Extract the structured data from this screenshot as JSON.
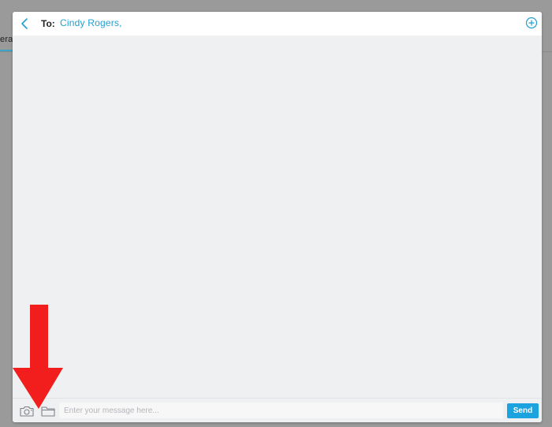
{
  "background_app": {
    "tab_label_fragment": "erac"
  },
  "header": {
    "to_label": "To:",
    "recipient": "Cindy Rogers,"
  },
  "compose": {
    "placeholder": "Enter your message here...",
    "send_label": "Send"
  },
  "icons": {
    "back": "chevron-left-icon",
    "add": "plus-circle-icon",
    "camera": "camera-icon",
    "folder": "folder-icon",
    "annotation": "red-down-arrow"
  },
  "colors": {
    "accent": "#1f9fd3",
    "send_button": "#1aa3de",
    "annotation_arrow": "#f21d1d",
    "message_background": "#eff0f2"
  }
}
